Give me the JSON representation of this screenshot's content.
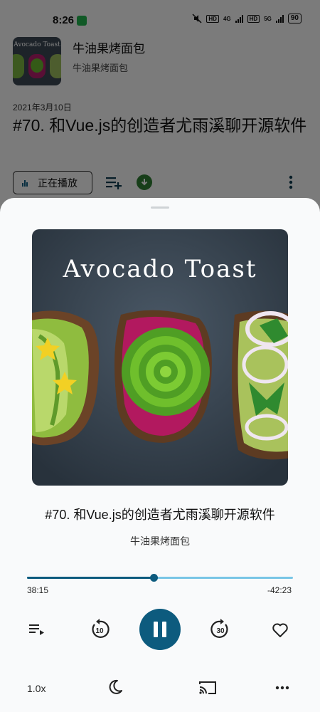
{
  "status_bar": {
    "time": "8:26",
    "badge_hd1": "HD",
    "net1": "4G",
    "badge_hd2": "HD",
    "net2": "5G",
    "battery": "90"
  },
  "background": {
    "podcast_name": "牛油果烤面包",
    "podcast_sub": "牛油果烤面包",
    "thumb_title": "Avocado Toast",
    "episode_date": "2021年3月10日",
    "episode_title": "#70. 和Vue.js的创造者尤雨溪聊开源软件",
    "playing_label": "正在播放"
  },
  "player": {
    "cover_title": "Avocado Toast",
    "title": "#70. 和Vue.js的创造者尤雨溪聊开源软件",
    "podcast": "牛油果烤面包",
    "elapsed": "38:15",
    "remaining": "-42:23",
    "progress_fraction": 0.475,
    "rewind_seconds": "10",
    "forward_seconds": "30",
    "speed": "1.0x"
  },
  "colors": {
    "accent": "#0d5b7e",
    "track": "#79c6e6",
    "download": "#2e7d32"
  },
  "icons": {
    "queue": "queue-icon",
    "rewind": "replay-10-icon",
    "play_pause": "pause-icon",
    "forward": "forward-30-icon",
    "favorite": "heart-icon",
    "sleep": "moon-icon",
    "cast": "cast-icon",
    "more": "more-horizontal-icon"
  }
}
